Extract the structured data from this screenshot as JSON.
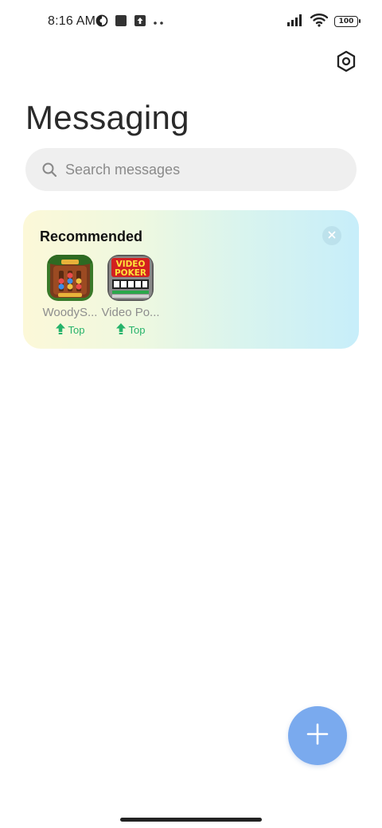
{
  "status_bar": {
    "time": "8:16 AM",
    "left_icons": [
      "theme-icon",
      "square-notification-icon",
      "upload-notification-icon",
      "more-dots-icon"
    ],
    "right_icons": [
      "signal-icon",
      "wifi-icon",
      "battery-icon"
    ],
    "battery_level": "100"
  },
  "header": {
    "settings_icon": "settings-hexagon-icon",
    "title": "Messaging"
  },
  "search": {
    "placeholder": "Search messages"
  },
  "recommended": {
    "title": "Recommended",
    "close_icon": "close-icon",
    "apps": [
      {
        "name": "WoodyS...",
        "badge": "Top",
        "icon": "woody-sort-app-icon"
      },
      {
        "name": "Video Po...",
        "badge": "Top",
        "icon": "video-poker-app-icon",
        "icon_text_line1": "VIDEO",
        "icon_text_line2": "POKER"
      }
    ]
  },
  "fab": {
    "icon": "plus-icon"
  },
  "colors": {
    "accent": "#7aaaee",
    "badge_green": "#27b36b",
    "search_bg": "#efefef"
  }
}
